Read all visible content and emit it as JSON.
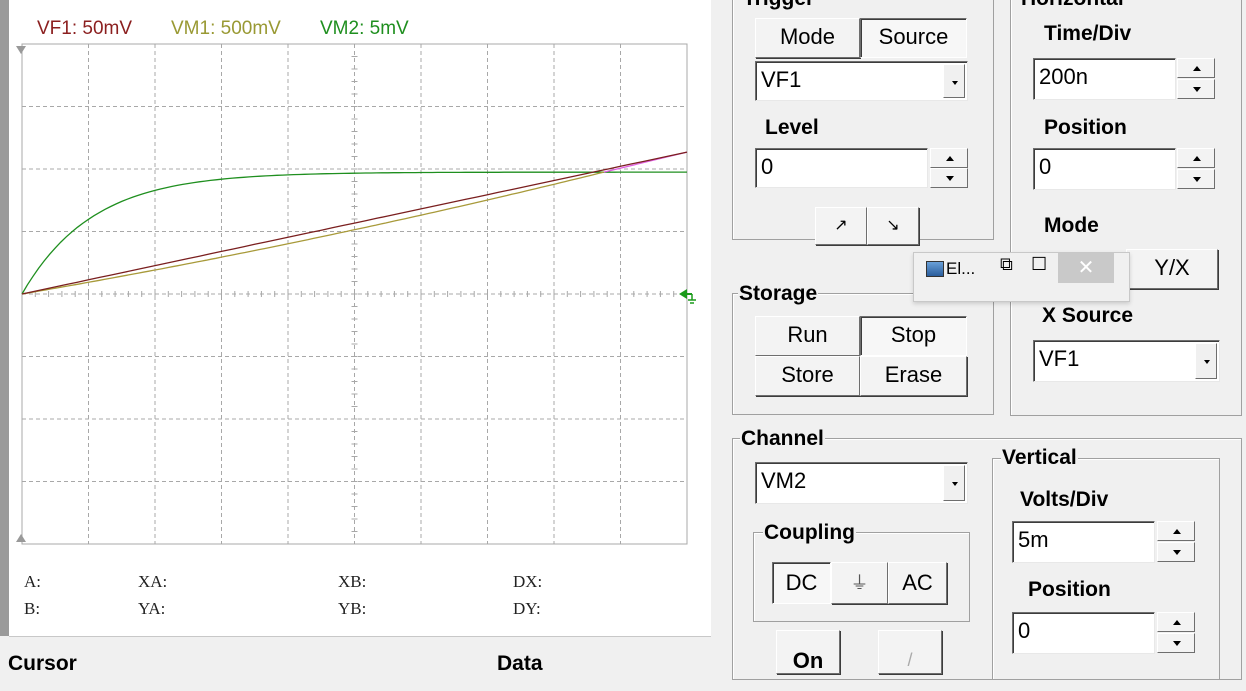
{
  "scope": {
    "labels": [
      {
        "text": "VF1: 50mV",
        "color": "#8b1f1f"
      },
      {
        "text": "VM1: 500mV",
        "color": "#999933"
      },
      {
        "text": "VM2: 5mV",
        "color": "#1f8f1f"
      }
    ],
    "readouts": {
      "a": "A:",
      "b": "B:",
      "xa": "XA:",
      "ya": "YA:",
      "xb": "XB:",
      "yb": "YB:",
      "dx": "DX:",
      "dy": "DY:"
    },
    "bottom_titles": {
      "cursor": "Cursor",
      "data": "Data"
    }
  },
  "trigger": {
    "title": "Trigger",
    "mode_label": "Mode",
    "source_label": "Source",
    "source_value": "VF1",
    "level_label": "Level",
    "level_value": "0",
    "rise_glyph": "↗",
    "fall_glyph": "↘"
  },
  "horizontal": {
    "title": "Horizontal",
    "timediv_label": "Time/Div",
    "timediv_value": "200n",
    "position_label": "Position",
    "position_value": "0",
    "mode_label": "Mode",
    "yx_label": "Y/X",
    "xsource_label": "X Source",
    "xsource_value": "VF1"
  },
  "storage": {
    "title": "Storage",
    "run_label": "Run",
    "stop_label": "Stop",
    "store_label": "Store",
    "erase_label": "Erase"
  },
  "channel": {
    "title": "Channel",
    "value": "VM2",
    "coupling_title": "Coupling",
    "dc_label": "DC",
    "gnd_label": "⏚",
    "ac_label": "AC",
    "on_label": "On",
    "probe_glyph": "/"
  },
  "vertical": {
    "title": "Vertical",
    "voltsdiv_label": "Volts/Div",
    "voltsdiv_value": "5m",
    "position_label": "Position",
    "position_value": "0"
  },
  "mini_window": {
    "title": "El...",
    "restore_glyph": "⧉",
    "maximize_glyph": "☐",
    "close_glyph": "✕"
  },
  "trace_colors": {
    "vf1": "#7a1f1f",
    "vm1": "#a89a3a",
    "vm2": "#1f8f1f",
    "extension": "#e060e0",
    "grid": "#a8a8a8",
    "marker": "#1a9a1a"
  }
}
